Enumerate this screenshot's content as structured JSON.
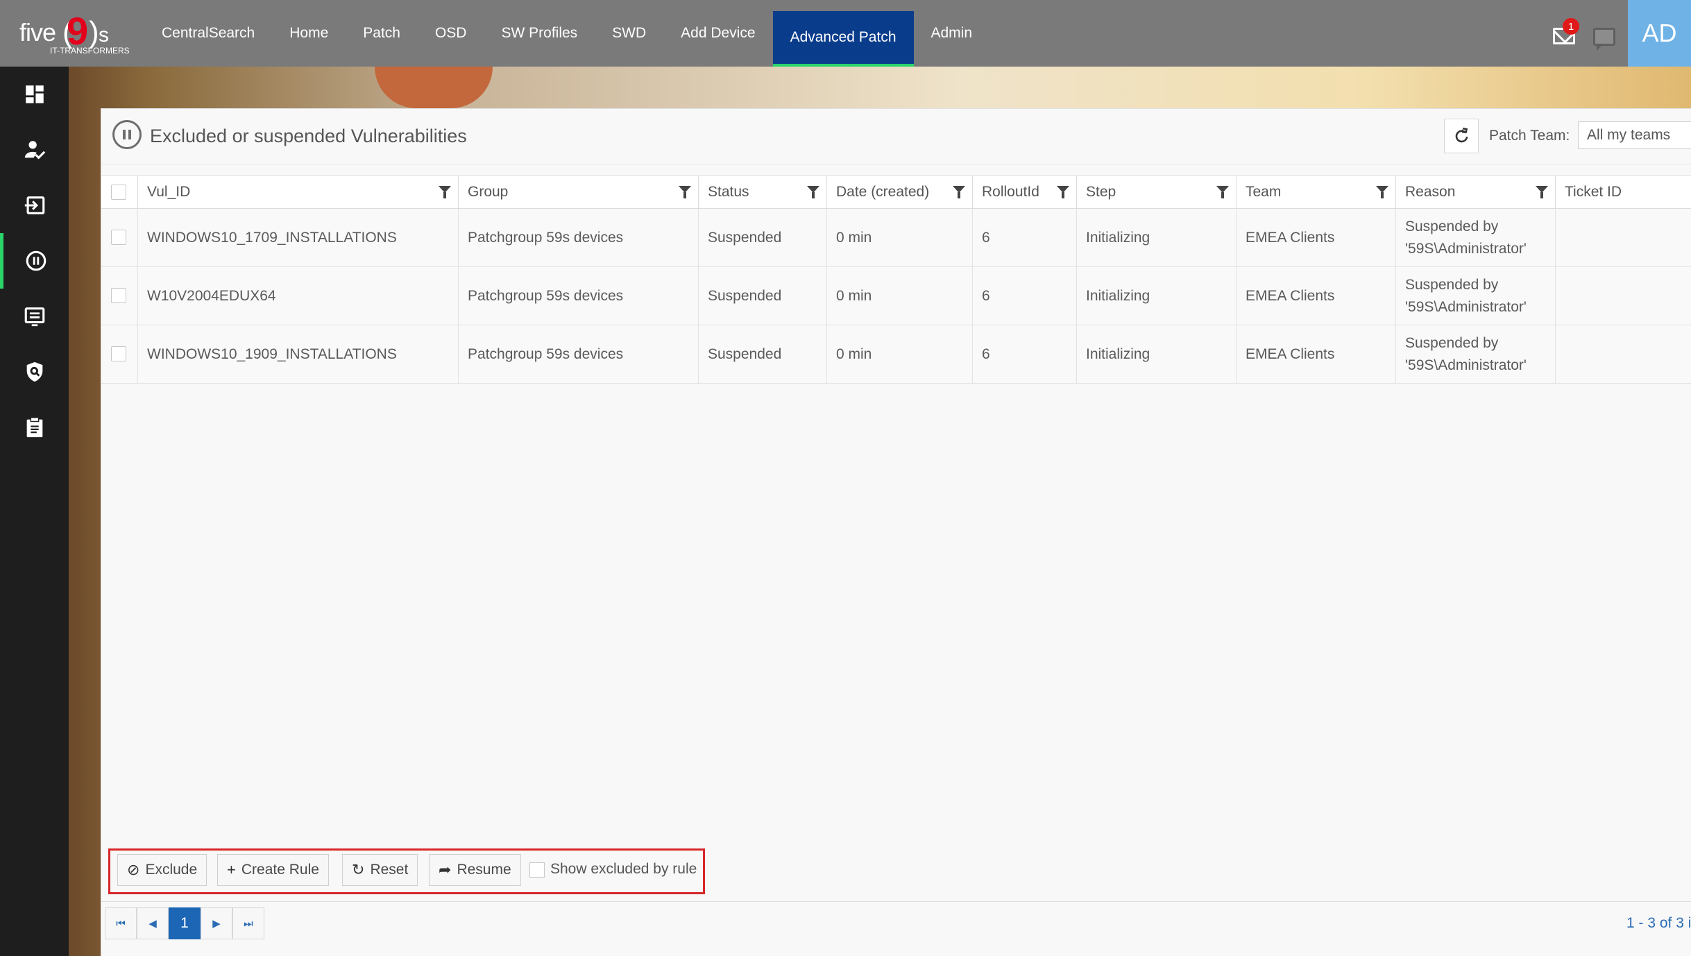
{
  "brand": {
    "logo_main": "five",
    "logo_nine": "9",
    "logo_s": "s",
    "logo_sub": "IT-TRANSFORMERS"
  },
  "nav": {
    "items": [
      {
        "label": "CentralSearch"
      },
      {
        "label": "Home"
      },
      {
        "label": "Patch"
      },
      {
        "label": "OSD"
      },
      {
        "label": "SW Profiles"
      },
      {
        "label": "SWD"
      },
      {
        "label": "Add Device"
      },
      {
        "label": "Advanced Patch",
        "active": true
      },
      {
        "label": "Admin"
      }
    ]
  },
  "header_right": {
    "mail_badge": "1",
    "mail_icon": "envelope-icon",
    "chat_icon": "chat-icon",
    "avatar": "AD"
  },
  "sidebar": {
    "items": [
      {
        "icon": "dashboard-icon"
      },
      {
        "icon": "user-check-icon"
      },
      {
        "icon": "login-box-icon"
      },
      {
        "icon": "pause-circle-icon",
        "active": true
      },
      {
        "icon": "list-monitor-icon"
      },
      {
        "icon": "shield-search-icon"
      },
      {
        "icon": "clipboard-icon"
      }
    ]
  },
  "panel": {
    "title": "Excluded or suspended Vulnerabilities",
    "patch_team_label": "Patch Team:",
    "patch_team_value": "All my teams"
  },
  "table": {
    "columns": [
      "Vul_ID",
      "Group",
      "Status",
      "Date (created)",
      "RolloutId",
      "Step",
      "Team",
      "Reason",
      "Ticket ID"
    ],
    "rows": [
      {
        "vul_id": "WINDOWS10_1709_INSTALLATIONS",
        "group": "Patchgroup 59s devices",
        "status": "Suspended",
        "date": "0 min",
        "rollout": "6",
        "step": "Initializing",
        "team": "EMEA Clients",
        "reason": "Suspended by '59S\\Administrator'",
        "ticket": ""
      },
      {
        "vul_id": "W10V2004EDUX64",
        "group": "Patchgroup 59s devices",
        "status": "Suspended",
        "date": "0 min",
        "rollout": "6",
        "step": "Initializing",
        "team": "EMEA Clients",
        "reason": "Suspended by '59S\\Administrator'",
        "ticket": ""
      },
      {
        "vul_id": "WINDOWS10_1909_INSTALLATIONS",
        "group": "Patchgroup 59s devices",
        "status": "Suspended",
        "date": "0 min",
        "rollout": "6",
        "step": "Initializing",
        "team": "EMEA Clients",
        "reason": "Suspended by '59S\\Administrator'",
        "ticket": ""
      }
    ]
  },
  "toolbar": {
    "exclude": "Exclude",
    "create_rule": "Create Rule",
    "reset": "Reset",
    "resume": "Resume",
    "show_excluded": "Show excluded by rule"
  },
  "pager": {
    "current_page": "1",
    "info": "1 - 3 of 3 i"
  },
  "colors": {
    "topbar": "#7a7a7a",
    "active_nav": "#0a3c8c",
    "accent_green": "#2bd46a",
    "avatar": "#6fb2e6",
    "highlight_red": "#d7262a",
    "pager_blue": "#1c66b5"
  }
}
